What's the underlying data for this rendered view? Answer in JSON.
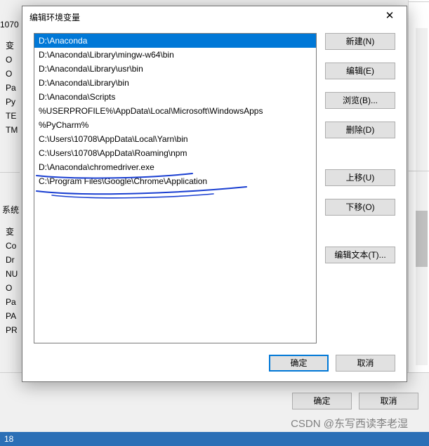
{
  "background": {
    "top_number_fragment": "1070",
    "left_labels_top": [
      "变",
      "O",
      "O",
      "Pa",
      "Py",
      "TE",
      "TM"
    ],
    "sys_label": "系统",
    "left_labels_bottom": [
      "变",
      "Co",
      "Dr",
      "NU",
      "O",
      "Pa",
      "PA",
      "PR"
    ],
    "btn_ok": "确定",
    "btn_cancel": "取消",
    "status_left": "18",
    "watermark": "CSDN @东写西读李老湿"
  },
  "dialog": {
    "title": "编辑环境变量",
    "list": [
      "D:\\Anaconda",
      "D:\\Anaconda\\Library\\mingw-w64\\bin",
      "D:\\Anaconda\\Library\\usr\\bin",
      "D:\\Anaconda\\Library\\bin",
      "D:\\Anaconda\\Scripts",
      "%USERPROFILE%\\AppData\\Local\\Microsoft\\WindowsApps",
      "%PyCharm%",
      "C:\\Users\\10708\\AppData\\Local\\Yarn\\bin",
      "C:\\Users\\10708\\AppData\\Roaming\\npm",
      "D:\\Anaconda\\chromedriver.exe",
      "C:\\Program Files\\Google\\Chrome\\Application"
    ],
    "selected_index": 0,
    "buttons": {
      "new": "新建(N)",
      "edit": "编辑(E)",
      "browse": "浏览(B)...",
      "delete": "删除(D)",
      "moveup": "上移(U)",
      "movedown": "下移(O)",
      "edittext": "编辑文本(T)..."
    },
    "footer": {
      "ok": "确定",
      "cancel": "取消"
    }
  }
}
